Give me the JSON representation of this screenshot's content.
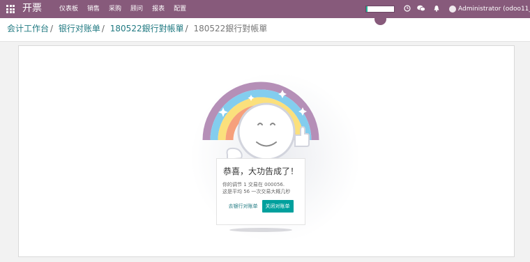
{
  "app": {
    "name": "开票"
  },
  "menu": {
    "items": [
      "仪表板",
      "销售",
      "采购",
      "顾问",
      "报表",
      "配置"
    ]
  },
  "topbar": {
    "progress": 0.05,
    "user_name": "Administrator (odoo11_..."
  },
  "breadcrumb": {
    "items": [
      "会计工作台",
      "银行对账单",
      "180522銀行對帳單"
    ],
    "current": "180522銀行對帳單"
  },
  "card": {
    "title": "恭喜，大功告成了！",
    "line1": "你的调节 1 交易在 000056.",
    "line2": "这是平均 56 一次交易大概几秒",
    "link_label": "去银行对账单",
    "button_label": "关闭对账单"
  },
  "colors": {
    "navbar": "#875a7b",
    "link": "#217a82",
    "primary": "#00a09d"
  }
}
